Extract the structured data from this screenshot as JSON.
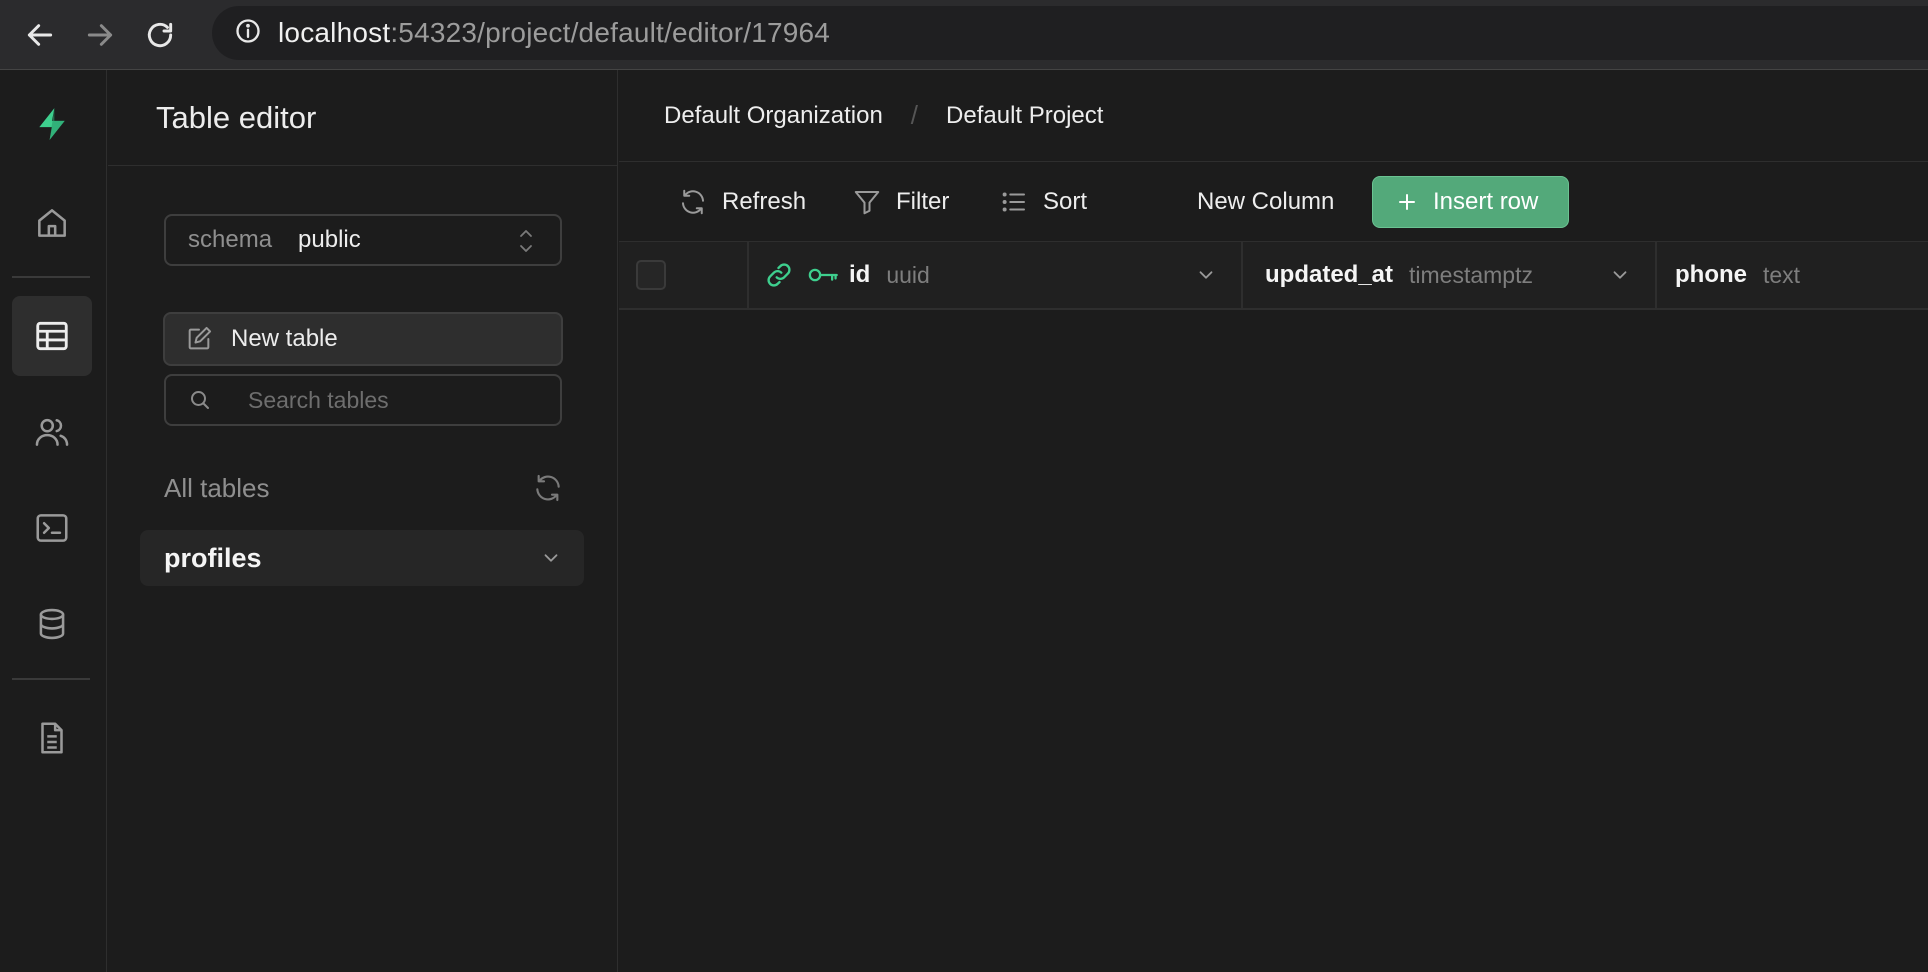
{
  "browser": {
    "url_host": "localhost",
    "url_path": ":54323/project/default/editor/17964"
  },
  "sidebar": {
    "title": "Table editor",
    "schema_label": "schema",
    "schema_value": "public",
    "new_table_label": "New table",
    "search_placeholder": "Search tables",
    "all_tables_label": "All tables",
    "tables": [
      {
        "name": "profiles"
      }
    ]
  },
  "breadcrumbs": {
    "organization": "Default Organization",
    "separator": "/",
    "project": "Default Project"
  },
  "toolbar": {
    "refresh_label": "Refresh",
    "filter_label": "Filter",
    "sort_label": "Sort",
    "new_column_label": "New Column",
    "insert_row_label": "Insert row"
  },
  "columns": [
    {
      "name": "id",
      "type": "uuid"
    },
    {
      "name": "updated_at",
      "type": "timestamptz"
    },
    {
      "name": "phone",
      "type": "text"
    }
  ],
  "colors": {
    "accent": "#3ecf8e",
    "background": "#1c1c1c"
  },
  "icons": {
    "rail": [
      "supabase-logo",
      "home-icon",
      "table-icon",
      "users-icon",
      "terminal-icon",
      "database-icon",
      "document-icon"
    ]
  }
}
